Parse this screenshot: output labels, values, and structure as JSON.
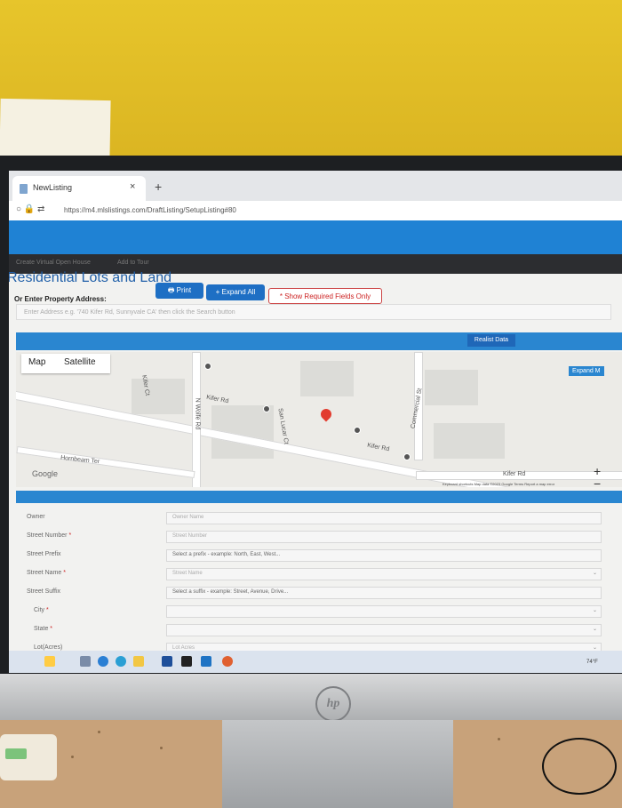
{
  "browser": {
    "tab_title": "NewListing",
    "tab_close": "×",
    "new_tab": "+",
    "url": "https://m4.mlslistings.com/DraftListing/SetupListing#80"
  },
  "site_nav": {
    "items": [
      "Create Virtual Open House",
      "Add to Tour"
    ]
  },
  "page": {
    "title": "Residential Lots and Land",
    "print_label": "Print",
    "expand_label": "+ Expand All",
    "required_label": "* Show Required Fields Only",
    "address_label": "Or Enter Property Address:",
    "address_placeholder": "Enter Address e.g. '740 Kifer Rd, Sunnyvale CA' then click the Search button",
    "realist_label": "Realist Data",
    "expand_map_label": "Expand M"
  },
  "map": {
    "tabs": [
      "Map",
      "Satellite"
    ],
    "streets": [
      "Kifer Rd",
      "Kifer Ct",
      "N Wolfe Rd",
      "San Lucar Ct",
      "Commercial St",
      "Hornbeam Ter",
      "Kifer Rd",
      "Kifer Rd"
    ],
    "google_label": "Google",
    "zoom_in": "+",
    "zoom_out": "−",
    "footer": "Keyboard shortcuts   Map data ©2023 Google   Terms   Report a map error"
  },
  "form": {
    "fields": [
      {
        "label": "Owner",
        "required": false,
        "placeholder": "Owner Name",
        "type": "text"
      },
      {
        "label": "Street Number",
        "required": true,
        "placeholder": "Street Number",
        "type": "text"
      },
      {
        "label": "Street Prefix",
        "required": false,
        "placeholder": "Select a prefix - example: North, East, West...",
        "type": "select-text"
      },
      {
        "label": "Street Name",
        "required": true,
        "placeholder": "Street Name",
        "type": "select"
      },
      {
        "label": "Street Suffix",
        "required": false,
        "placeholder": "Select a suffix - example: Street, Avenue, Drive...",
        "type": "select-text"
      },
      {
        "label": "City",
        "required": true,
        "placeholder": "",
        "type": "select"
      },
      {
        "label": "State",
        "required": true,
        "placeholder": "",
        "type": "select"
      },
      {
        "label": "Lot(Acres)",
        "required": false,
        "placeholder": "Lot Acres",
        "type": "select"
      }
    ]
  },
  "taskbar": {
    "temperature": "74°F"
  },
  "monitor": {
    "brand": "hp"
  },
  "colors": {
    "accent": "#1f82d4",
    "title": "#2160a9",
    "required": "#cc2222",
    "wall": "#d9b21d"
  }
}
